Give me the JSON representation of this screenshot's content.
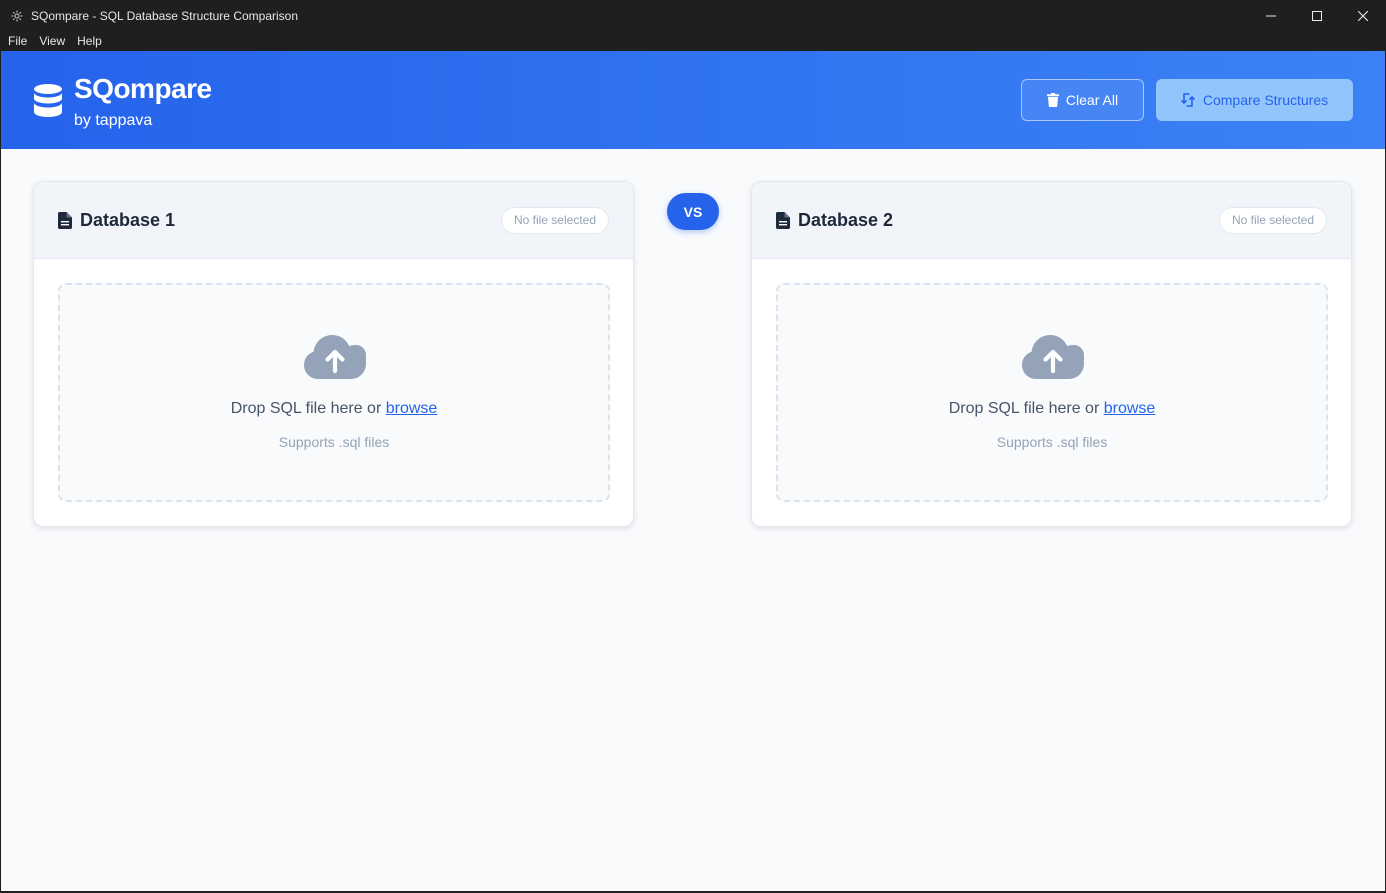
{
  "window": {
    "title": "SQompare - SQL Database Structure Comparison",
    "app_icon": "gear-icon",
    "controls": [
      "minimize-icon",
      "maximize-icon",
      "close-icon"
    ]
  },
  "menu": {
    "items": [
      {
        "label": "File"
      },
      {
        "label": "View"
      },
      {
        "label": "Help"
      }
    ]
  },
  "header": {
    "brand_icon": "database-icon",
    "title": "SQompare",
    "subtitle": "by tappava",
    "clear_button": {
      "label": "Clear All",
      "icon": "trash-icon"
    },
    "compare_button": {
      "label": "Compare Structures",
      "icon": "sync-icon",
      "state": "disabled"
    }
  },
  "vs_label": "VS",
  "panels": [
    {
      "title": "Database 1",
      "icon": "file-icon",
      "status": "No file selected",
      "drop_text": "Drop SQL file here or ",
      "browse_label": "browse",
      "supports_text": "Supports .sql files",
      "upload_icon": "cloud-upload-icon"
    },
    {
      "title": "Database 2",
      "icon": "file-icon",
      "status": "No file selected",
      "drop_text": "Drop SQL file here or ",
      "browse_label": "browse",
      "supports_text": "Supports .sql files",
      "upload_icon": "cloud-upload-icon"
    }
  ],
  "colors": {
    "accent": "#2563eb",
    "header_gradient_start": "#2563eb",
    "header_gradient_end": "#3b82f6",
    "background": "#f8fafc"
  }
}
